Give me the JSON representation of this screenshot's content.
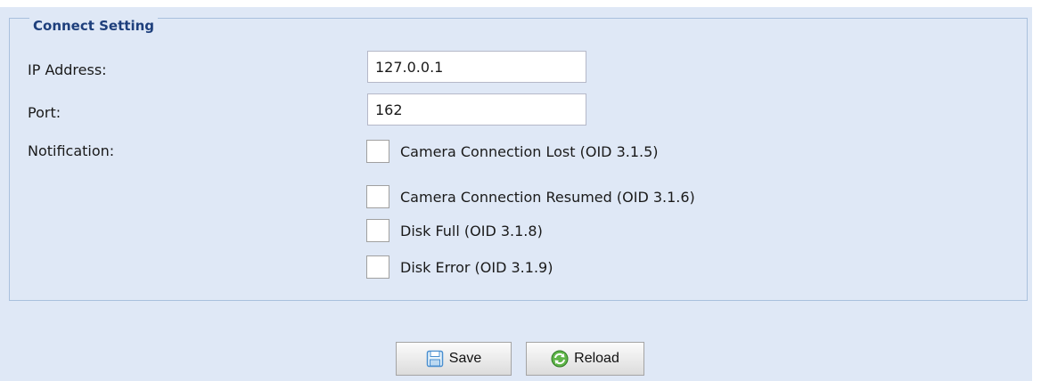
{
  "connect_setting": {
    "legend": "Connect Setting",
    "ip_address": {
      "label": "IP Address:",
      "value": "127.0.0.1"
    },
    "port": {
      "label": "Port:",
      "value": "162"
    },
    "notification": {
      "label": "Notification:",
      "options": [
        {
          "label": "Camera Connection Lost (OID 3.1.5)",
          "checked": false
        },
        {
          "label": "Camera Connection Resumed (OID 3.1.6)",
          "checked": false
        },
        {
          "label": "Disk Full (OID 3.1.8)",
          "checked": false
        },
        {
          "label": "Disk Error (OID 3.1.9)",
          "checked": false
        }
      ]
    }
  },
  "buttons": {
    "save": {
      "label": "Save",
      "icon": "save-icon"
    },
    "reload": {
      "label": "Reload",
      "icon": "reload-icon"
    }
  },
  "colors": {
    "panel_bg": "#dfe8f6",
    "legend_text": "#1e3f7c",
    "border": "#a9c0dd"
  }
}
